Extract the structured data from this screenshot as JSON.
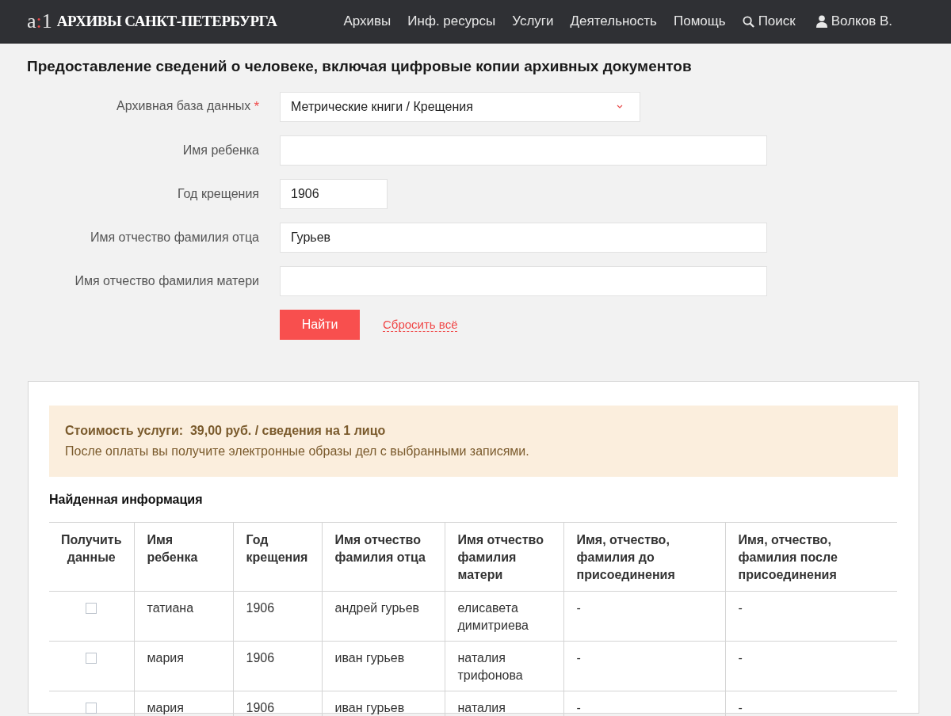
{
  "header": {
    "logo": [
      "a",
      ":",
      "1"
    ],
    "site_title": "АРХИВЫ САНКТ-ПЕТЕРБУРГА",
    "nav": [
      {
        "label": "Архивы",
        "kind": "link"
      },
      {
        "label": "Инф. ресурсы",
        "kind": "link"
      },
      {
        "label": "Услуги",
        "kind": "link"
      },
      {
        "label": "Деятельность",
        "kind": "link"
      },
      {
        "label": "Помощь",
        "kind": "link"
      },
      {
        "label": "Поиск",
        "kind": "search"
      },
      {
        "label": "Волков В.",
        "kind": "account"
      }
    ]
  },
  "page_title": "Предоставление сведений о человеке, включая цифровые копии архивных документов",
  "form": {
    "fields": [
      {
        "kind": "select",
        "label": "Архивная база данных",
        "required_mark": "*",
        "value": "Метрические книги / Крещения"
      },
      {
        "kind": "text",
        "label": "Имя ребенка"
      },
      {
        "kind": "text",
        "label": "Год крещения",
        "value": "1906"
      },
      {
        "kind": "text",
        "label": "Имя отчество фамилия отца",
        "value": "Гурьев"
      },
      {
        "kind": "text",
        "label": "Имя отчество фамилия матери"
      }
    ],
    "submit": "Найти",
    "reset": "Сбросить всё"
  },
  "results": {
    "notice": {
      "price": "Стоимость услуги:  39,00 руб. / сведения на 1 лицо",
      "text": "После оплаты вы получите электронные образы дел с выбранными записями."
    },
    "heading": "Найденная информация",
    "table": {
      "columns": [
        "Получить данные",
        "Имя ребенка",
        "Год крещения",
        "Имя отчество фамилия отца",
        "Имя отчество фамилия матери",
        "Имя, отчество, фамилия до присоединения",
        "Имя, отчество, фамилия после присоединения"
      ],
      "rows": [
        {
          "checked": false,
          "cells": [
            "",
            "татиана",
            "1906",
            "андрей гурьев",
            "елисавета димитриева",
            "-",
            "-"
          ]
        },
        {
          "checked": false,
          "cells": [
            "",
            "мария",
            "1906",
            "иван гурьев",
            "наталия трифонова",
            "-",
            "-"
          ]
        },
        {
          "checked": false,
          "cells": [
            "",
            "мария",
            "1906",
            "иван гурьев",
            "наталия",
            "-",
            "-"
          ]
        }
      ]
    }
  }
}
